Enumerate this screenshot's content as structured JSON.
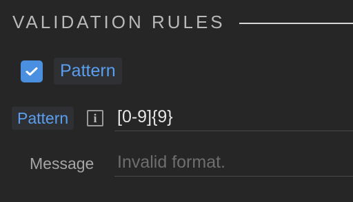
{
  "section": {
    "title": "VALIDATION RULES"
  },
  "pattern_toggle": {
    "checked": true,
    "label": "Pattern"
  },
  "pattern_field": {
    "label": "Pattern",
    "info_icon": "info-icon",
    "value": "[0-9]{9}"
  },
  "message_field": {
    "label": "Message",
    "value": "",
    "placeholder": "Invalid format."
  },
  "colors": {
    "background": "#262626",
    "accent": "#4a8fe0",
    "link_text": "#5a9ff0"
  }
}
